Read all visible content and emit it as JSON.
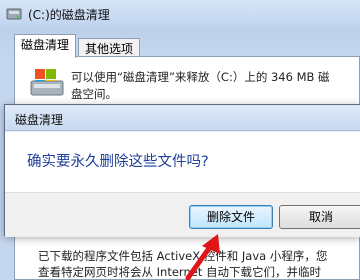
{
  "background_window": {
    "title": "(C:)的磁盘清理",
    "tabs": [
      {
        "label": "磁盘清理",
        "active": true
      },
      {
        "label": "其他选项",
        "active": false
      }
    ],
    "description_lines": [
      "可以使用“磁盘清理”来释放（C:）上的 346 MB 磁",
      "盘空间。"
    ],
    "lower_text_lines": [
      "已下载的程序文件包括 ActiveX 控件和 Java 小程序，您",
      "查看特定网页时将会从 Internet 自动下载它们，并临时"
    ]
  },
  "dialog": {
    "title": "磁盘清理",
    "question": "确实要永久删除这些文件吗?",
    "confirm_label": "删除文件",
    "cancel_label": "取消"
  },
  "colors": {
    "question_text": "#1e3f9a",
    "annotation_arrow": "#e0151a"
  }
}
